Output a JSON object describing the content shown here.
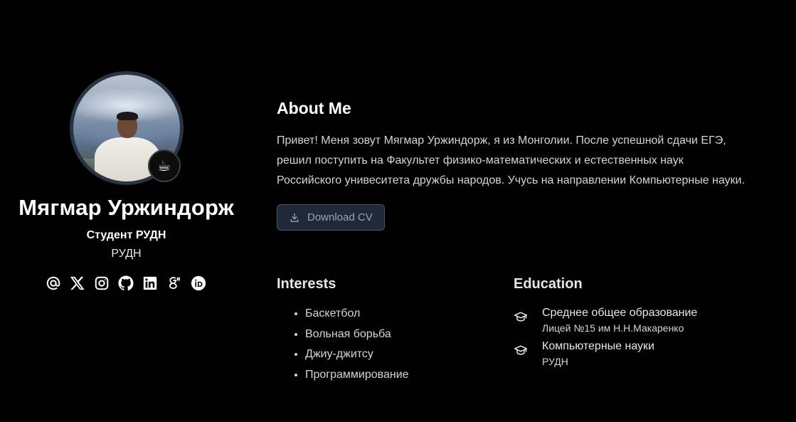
{
  "profile": {
    "name": "Мягмар Уржиндорж",
    "role": "Студент РУДН",
    "organization": "РУДН",
    "avatar_badge": "☕",
    "socials": [
      {
        "icon": "email-icon"
      },
      {
        "icon": "x-icon"
      },
      {
        "icon": "instagram-icon"
      },
      {
        "icon": "github-icon"
      },
      {
        "icon": "linkedin-icon"
      },
      {
        "icon": "google-scholar-icon"
      },
      {
        "icon": "orcid-icon"
      }
    ]
  },
  "about": {
    "title": "About Me",
    "text": "Привет! Меня зовут Мягмар Уржиндорж, я из Монголии. После успешной сдачи ЕГЭ, решил поступить на Факультет физико-математических и естественных наук Российского унивеситета дружбы народов. Учусь на направлении Компьютерные науки.",
    "cv_button_label": "Download CV"
  },
  "interests": {
    "title": "Interests",
    "items": [
      "Баскетбол",
      "Вольная борьба",
      "Джиу-джитсу",
      "Программирование"
    ]
  },
  "education": {
    "title": "Education",
    "items": [
      {
        "degree": "Среднее общее образование",
        "institution": "Лицей №15 им Н.Н.Макаренко"
      },
      {
        "degree": "Компьютерные науки",
        "institution": "РУДН"
      }
    ]
  },
  "colors": {
    "background": "#000000",
    "button_bg": "#1f2937",
    "text": "#d1d5db"
  }
}
